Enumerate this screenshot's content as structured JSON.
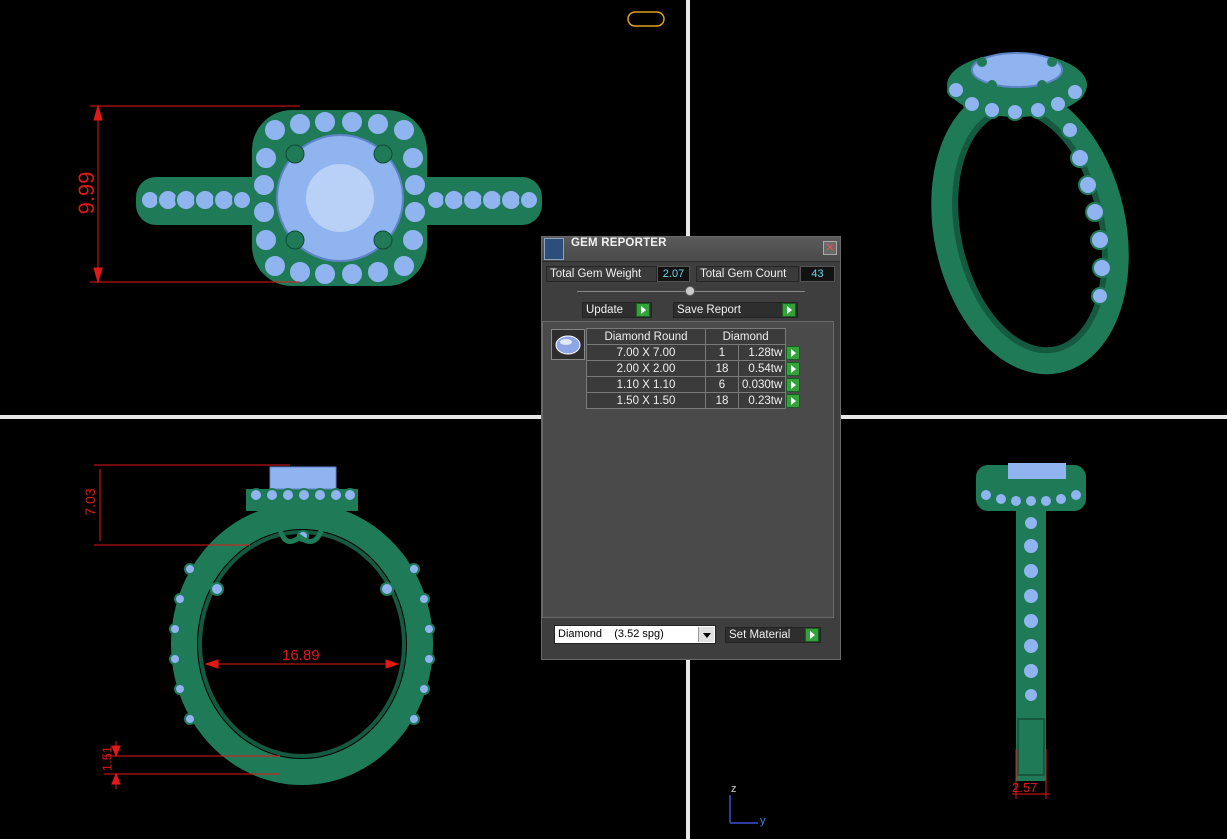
{
  "panel": {
    "title": "GEM REPORTER",
    "total_weight_label": "Total Gem Weight",
    "total_weight_value": "2.07",
    "total_count_label": "Total Gem Count",
    "total_count_value": "43",
    "update_label": "Update",
    "save_report_label": "Save Report",
    "table": {
      "col1_header": "Diamond Round",
      "col2_header": "Diamond",
      "rows": [
        {
          "size": "7.00 X 7.00",
          "count": "1",
          "weight": "1.28tw"
        },
        {
          "size": "2.00 X 2.00",
          "count": "18",
          "weight": "0.54tw"
        },
        {
          "size": "1.10 X 1.10",
          "count": "6",
          "weight": "0.030tw"
        },
        {
          "size": "1.50 X 1.50",
          "count": "18",
          "weight": "0.23tw"
        }
      ]
    },
    "material_value": "Diamond    (3.52 spg)",
    "set_material_label": "Set Material"
  },
  "dimensions": {
    "top_height": "9.99",
    "front_height": "7.03",
    "inner_diameter": "16.89",
    "shank_thickness": "1.51",
    "side_width": "2.57"
  },
  "axes": {
    "z": "z",
    "y": "y"
  },
  "colors": {
    "metal": "#1f7a58",
    "gem": "#8fb4f0",
    "dimension": "#e01818",
    "go_button": "#33a23a"
  }
}
